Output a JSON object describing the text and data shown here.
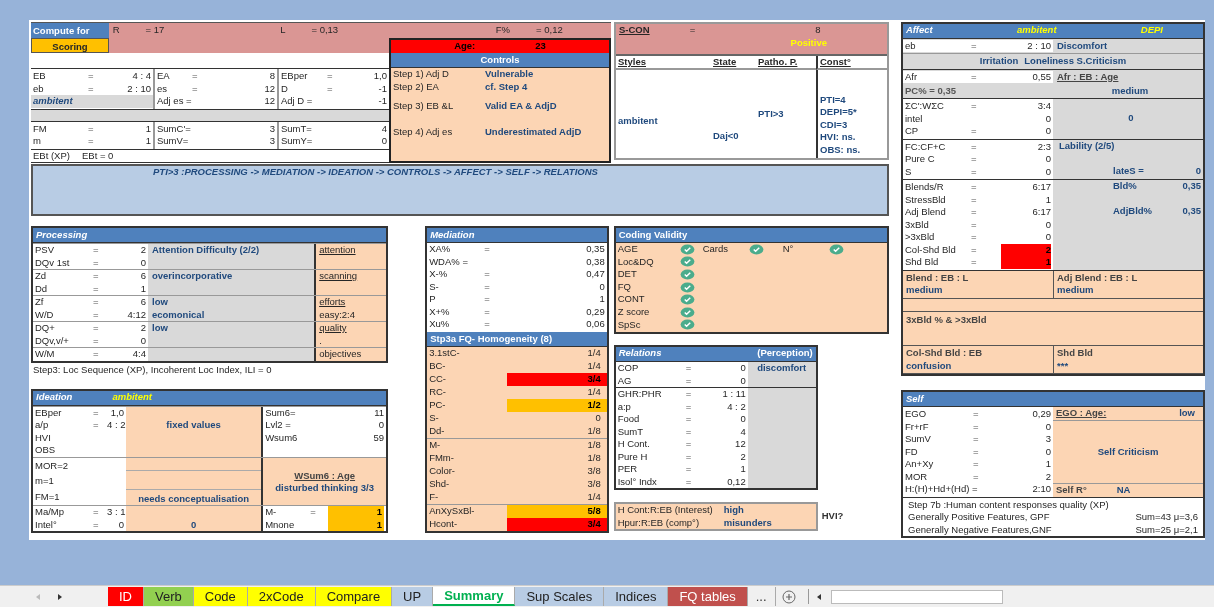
{
  "summary": {
    "compute_label": "Compute for",
    "scoring": "Scoring",
    "measures": [
      {
        "label": "R",
        "value": "= 17"
      },
      {
        "label": "L",
        "value": "=   0,13"
      },
      {
        "label": "F%",
        "value": "= 0,12"
      }
    ],
    "age": {
      "label": "Age:",
      "value": "23"
    },
    "upper": [
      [
        {
          "label": "EB",
          "eq": "=",
          "value": "4 : 4"
        },
        {
          "label": "eb",
          "eq": "=",
          "value": "2 : 10"
        },
        {
          "kind": "style",
          "text": "ambitent"
        }
      ],
      [
        {
          "label": "EA",
          "eq": "=",
          "value": "8"
        },
        {
          "label": "es",
          "eq": "=",
          "value": "12"
        },
        {
          "label": "Adj es =",
          "value": "12"
        }
      ],
      [
        {
          "label": "EBper",
          "eq": "=",
          "value": "1,0"
        },
        {
          "label": "D",
          "eq": "=",
          "value": "-1"
        },
        {
          "label": "Adj D =",
          "value": "-1"
        }
      ]
    ],
    "lower": [
      [
        {
          "label": "FM",
          "eq": "=",
          "value": "1"
        },
        {
          "label": "m",
          "eq": "=",
          "value": "1"
        }
      ],
      [
        {
          "label": "SumC'=",
          "value": "3"
        },
        {
          "label": "SumV=",
          "value": "3"
        }
      ],
      [
        {
          "label": "SumT=",
          "value": "4"
        },
        {
          "label": "SumY=",
          "value": "0"
        }
      ]
    ],
    "ebt": {
      "label": "EBt (XP)",
      "value": "EBt = 0"
    },
    "controls": {
      "title": "Controls",
      "steps": [
        {
          "step": "Step 1) Adj D",
          "result": "Vulnerable"
        },
        {
          "step": "Step 2) EA",
          "result": "cf. Step 4"
        },
        {
          "step": "Step 3) EB &L",
          "result": "Valid EA & AdjD"
        },
        {
          "step": "Step 4) Adj es",
          "result": "Underestimated AdjD"
        }
      ]
    }
  },
  "scon": {
    "label": "S-CON",
    "eq": "=",
    "value": "8",
    "status": "Positive",
    "headers": [
      "Styles",
      "State",
      "Patho. P.",
      "Const°"
    ],
    "style": "ambitent",
    "state": "Daj<0",
    "patho": "PTI>3",
    "constellations": [
      "PTI=4",
      "DEPI=5*",
      "CDI=3",
      "HVI: ns.",
      "OBS: ns."
    ]
  },
  "banner": "PTI>3 :PROCESSING -> MEDIATION -> IDEATION -> CONTROLS -> AFFECT -> SELF -> RELATIONS",
  "processing": {
    "title": "Processing",
    "groups": [
      {
        "entries": [
          {
            "label": "PSV",
            "eq": "=",
            "value": "2"
          },
          {
            "label": "DQv 1st",
            "eq": "=",
            "value": "0"
          }
        ],
        "notes": [
          "Attention Difficulty (2/2)"
        ],
        "side": [
          {
            "text": "attention",
            "underlined": true
          }
        ]
      },
      {
        "entries": [
          {
            "label": "Zd",
            "eq": "=",
            "value": "6"
          },
          {
            "label": "Dd",
            "eq": "=",
            "value": "1"
          }
        ],
        "notes": [
          "overincorporative"
        ],
        "side": [
          {
            "text": "scanning",
            "underlined": true
          }
        ]
      },
      {
        "entries": [
          {
            "label": "Zf",
            "eq": "=",
            "value": "6"
          },
          {
            "label": "W/D",
            "eq": "=",
            "value": "4:12"
          }
        ],
        "notes": [
          "low",
          "ecomonical"
        ],
        "side": [
          {
            "text": "efforts",
            "underlined": true
          },
          {
            "text": "easy:2:4",
            "underlined": false
          }
        ]
      },
      {
        "entries": [
          {
            "label": "DQ+",
            "eq": "=",
            "value": "2"
          },
          {
            "label": "DQv,v/+",
            "eq": "=",
            "value": "0"
          }
        ],
        "notes": [
          "low"
        ],
        "side": [
          {
            "text": "quality",
            "underlined": true
          },
          {
            "text": ".",
            "underlined": false
          }
        ]
      },
      {
        "entries": [
          {
            "label": "W/M",
            "eq": "=",
            "value": "4:4"
          }
        ],
        "side": [
          {
            "text": "objectives",
            "underlined": false
          }
        ]
      }
    ],
    "note": "Step3: Loc Sequence (XP), Incoherent Loc Index, ILI = 0"
  },
  "ideation": {
    "title": "Ideation",
    "style": "ambitent",
    "a": {
      "entries": [
        {
          "label": "EBper",
          "eq": "=",
          "value": "1,0"
        },
        {
          "label": "a/p",
          "eq": "=",
          "value": "4 : 2"
        },
        {
          "label": "HVI"
        },
        {
          "label": "OBS"
        }
      ],
      "note": "fixed values",
      "scores": [
        {
          "label": "Sum6=",
          "value": "11"
        },
        {
          "label": "Lvl2 =",
          "value": "0"
        },
        {
          "label": "Wsum6",
          "value": "59"
        }
      ]
    },
    "b": {
      "entries": [
        {
          "label": "MOR=2"
        },
        {
          "label": "m=1"
        },
        {
          "label": "FM=1"
        }
      ],
      "note": "needs conceptualisation",
      "heading": "WSum6 : Age",
      "result": "disturbed thinking 3/3"
    },
    "c": {
      "entries": [
        {
          "label": "Ma/Mp",
          "eq": "=",
          "value": "3 : 1"
        },
        {
          "label": "Intel°",
          "eq": "=",
          "value": "0"
        }
      ],
      "note": "0",
      "scores": [
        {
          "label": "M-",
          "eq": "=",
          "value": "1",
          "color": "#ffc000"
        },
        {
          "label": "Mnone",
          "value": "1",
          "color": "#ffc000"
        }
      ]
    }
  },
  "mediation": {
    "title": "Mediation",
    "entries": [
      {
        "label": "XA%",
        "eq": "=",
        "value": "0,35"
      },
      {
        "label": "WDA% =",
        "value": "0,38"
      },
      {
        "label": "X-%",
        "eq": "=",
        "value": "0,47"
      },
      {
        "label": "S-",
        "eq": "=",
        "value": "0"
      },
      {
        "label": "P",
        "eq": "=",
        "value": "1"
      },
      {
        "label": "X+%",
        "eq": "=",
        "value": "0,29"
      },
      {
        "label": "Xu%",
        "eq": "=",
        "value": "0,06"
      }
    ]
  },
  "homogeneity": {
    "title": "Stp3a FQ- Homogeneity (8)",
    "items": [
      {
        "label": "3.1stC-",
        "value": "1/4"
      },
      {
        "label": "BC-",
        "value": "1/4"
      },
      {
        "label": "CC-",
        "value": "3/4",
        "color": "#ff0000"
      },
      {
        "label": "RC-",
        "value": "1/4"
      },
      {
        "label": "PC-",
        "value": "1/2",
        "color": "#ffc000"
      },
      {
        "label": "S-",
        "value": "0"
      },
      {
        "label": "Dd-",
        "value": "1/8"
      },
      {
        "label": "M-",
        "value": "1/8"
      },
      {
        "label": "FMm-",
        "value": "1/8"
      },
      {
        "label": "Color-",
        "value": "3/8"
      },
      {
        "label": "Shd-",
        "value": "3/8"
      },
      {
        "label": "F-",
        "value": "1/4"
      },
      {
        "label": "AnXySxBl-",
        "value": "5/8",
        "color": "#ffc000"
      },
      {
        "label": "Hcont-",
        "value": "3/4",
        "color": "#ff0000"
      }
    ]
  },
  "coding": {
    "title": "Coding Validity",
    "rows": [
      [
        {
          "label": "AGE",
          "checked": true
        },
        {
          "label": "Cards",
          "checked": true
        },
        {
          "label": "N°",
          "checked": true
        }
      ],
      [
        {
          "label": "Loc&DQ",
          "checked": true
        }
      ],
      [
        {
          "label": "DET",
          "checked": true
        }
      ],
      [
        {
          "label": "FQ",
          "checked": true
        }
      ],
      [
        {
          "label": "CONT",
          "checked": true
        }
      ],
      [
        {
          "label": "Z score",
          "checked": true
        }
      ],
      [
        {
          "label": "SpSc",
          "checked": true
        }
      ]
    ]
  },
  "relations": {
    "title": "Relations",
    "subtitle": "(Perception)",
    "groups": [
      {
        "entries": [
          {
            "label": "COP",
            "eq": "=",
            "value": "0"
          },
          {
            "label": "AG",
            "eq": "=",
            "value": "0"
          }
        ],
        "note": "discomfort"
      },
      {
        "entries": [
          {
            "label": "GHR:PHR",
            "eq": "=",
            "value": "1 : 11"
          },
          {
            "label": "a:p",
            "eq": "=",
            "value": "4 : 2"
          },
          {
            "label": "Food",
            "eq": "=",
            "value": "0"
          },
          {
            "label": "SumT",
            "eq": "=",
            "value": "4"
          },
          {
            "label": "H Cont.",
            "eq": "=",
            "value": "12"
          },
          {
            "label": "Pure H",
            "eq": "=",
            "value": "2"
          },
          {
            "label": "PER",
            "eq": "=",
            "value": "1"
          },
          {
            "label": "Isol° Indx",
            "eq": "=",
            "value": "0,12"
          }
        ]
      }
    ]
  },
  "interest": {
    "rows": [
      {
        "label": "H Cont:R:EB (Interest)",
        "value": "high"
      },
      {
        "label": "Hpur:R:EB (comp°)",
        "value": "misunders"
      }
    ],
    "flag": "HVI?"
  },
  "affect": {
    "title": "Affect",
    "style": "ambitent",
    "flag": "DEPI",
    "eb": {
      "label": "eb",
      "eq": "=",
      "value": "2 : 10"
    },
    "eb_note": "Discomfort",
    "feelings": [
      "Irritation",
      "Loneliness S.Criticism"
    ],
    "afr": {
      "label": "Afr",
      "eq": "=",
      "value": "0,55"
    },
    "afr_heading": "Afr : EB : Age",
    "pc": "PC% = 0,35",
    "afr_result": "medium",
    "groups": [
      {
        "entries": [
          {
            "label": "ΣC':WΣC",
            "eq": "=",
            "value": "3:4"
          },
          {
            "label": "intel",
            "value": "0"
          },
          {
            "label": "CP",
            "eq": "=",
            "value": "0"
          }
        ],
        "side": [
          {
            "kind": "blank"
          },
          {
            "kind": "center",
            "text": "0"
          },
          {
            "kind": "blank"
          }
        ]
      },
      {
        "entries": [
          {
            "label": "FC:CF+C",
            "eq": "=",
            "value": "2:3"
          },
          {
            "label": "Pure C",
            "eq": "=",
            "value": "0"
          },
          {
            "label": "S",
            "eq": "=",
            "value": "0"
          }
        ],
        "side": [
          {
            "kind": "note",
            "text": "Lability (2/5)"
          },
          {
            "kind": "blank"
          },
          {
            "kind": "pair",
            "label": "lateS =",
            "value": "0"
          }
        ]
      },
      {
        "entries": [
          {
            "label": "Blends/R",
            "eq": "=",
            "value": "6:17"
          },
          {
            "label": "StressBld",
            "eq": "=",
            "value": "1"
          },
          {
            "label": "Adj Blend",
            "eq": "=",
            "value": "6:17"
          },
          {
            "label": "3xBld",
            "eq": "=",
            "value": "0"
          },
          {
            "label": ">3xBld",
            "eq": "=",
            "value": "0"
          },
          {
            "label": "Col-Shd Bld",
            "eq": "=",
            "value": "2",
            "color": "#ff0000"
          },
          {
            "label": "Shd Bld",
            "eq": "=",
            "value": "1",
            "color": "#ff0000"
          }
        ],
        "side": [
          {
            "kind": "pair",
            "label": "Bld%",
            "value": "0,35"
          },
          {
            "kind": "blank"
          },
          {
            "kind": "pair",
            "label": "AdjBld%",
            "value": "0,35"
          }
        ]
      }
    ],
    "blend": [
      {
        "heading": "Blend : EB : L",
        "result": "medium"
      },
      {
        "heading": "Adj Blend : EB : L",
        "result": "medium"
      }
    ],
    "bld_note": "3xBld % & >3xBld",
    "colshd": [
      {
        "heading": "Col-Shd Bld : EB",
        "result": "confusion"
      },
      {
        "heading": "Shd Bld",
        "result": "***"
      }
    ]
  },
  "self": {
    "title": "Self",
    "entries": [
      {
        "label": "EGO",
        "eq": "=",
        "value": "0,29"
      },
      {
        "label": "Fr+rF",
        "eq": "=",
        "value": "0"
      },
      {
        "label": "SumV",
        "eq": "=",
        "value": "3"
      },
      {
        "label": "FD",
        "eq": "=",
        "value": "0"
      },
      {
        "label": "An+Xy",
        "eq": "=",
        "value": "1"
      },
      {
        "label": "MOR",
        "eq": "=",
        "value": "2"
      },
      {
        "label": "H:(H)+Hd+(Hd) =",
        "value": "2:10"
      }
    ],
    "ego": {
      "label": "EGO : Age:",
      "value": "low"
    },
    "criticism": "Self Criticism",
    "self_r": {
      "label": "Self R°",
      "value": "NA"
    },
    "step": "Step 7b :Human content responses quality (XP)",
    "features": [
      {
        "label": "Generally Positive Features, GPF",
        "value": "Sum=43  μ=3,6"
      },
      {
        "label": "Generally Negative Features,GNF",
        "value": "Sum=25  μ=2,1"
      }
    ]
  },
  "tabs": [
    {
      "label": "ID",
      "color": "#ff0000",
      "selected": false
    },
    {
      "label": "Verb",
      "color": "#92d050",
      "selected": false
    },
    {
      "label": "Code",
      "color": "#ffff00",
      "selected": false
    },
    {
      "label": "2xCode",
      "color": "#ffff00",
      "selected": false
    },
    {
      "label": "Compare",
      "color": "#ffff00",
      "selected": false
    },
    {
      "label": "UP",
      "color": "#b8cce4",
      "selected": false
    },
    {
      "label": "Summary",
      "color": "#00b050",
      "selected": true
    },
    {
      "label": "Sup Scales",
      "color": "#b8cce4",
      "selected": false
    },
    {
      "label": "Indices",
      "color": "#b8cce4",
      "selected": false
    },
    {
      "label": "FQ tables",
      "color": "#c0504d",
      "selected": false
    }
  ],
  "tab_more": "..."
}
